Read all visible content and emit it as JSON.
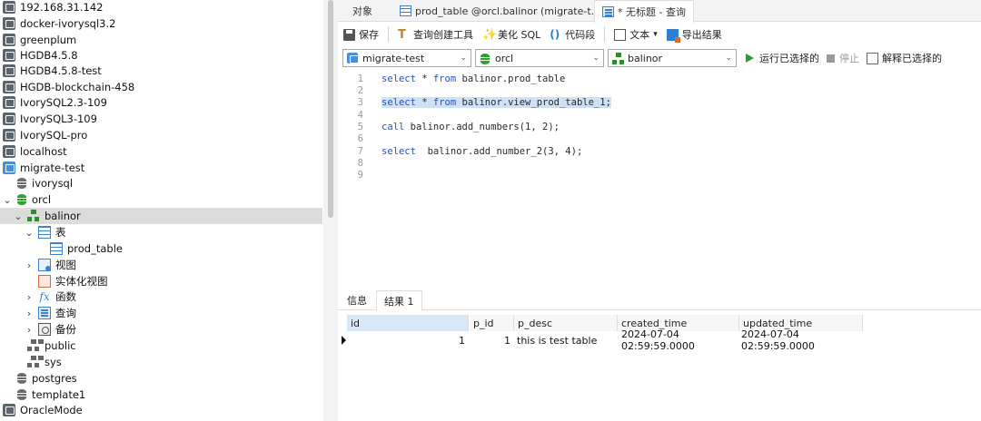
{
  "sidebar": {
    "items": [
      {
        "label": "192.168.31.142",
        "icon": "connection-icon"
      },
      {
        "label": "docker-ivorysql3.2",
        "icon": "connection-icon"
      },
      {
        "label": "greenplum",
        "icon": "connection-icon"
      },
      {
        "label": "HGDB4.5.8",
        "icon": "connection-icon"
      },
      {
        "label": "HGDB4.5.8-test",
        "icon": "connection-icon"
      },
      {
        "label": "HGDB-blockchain-458",
        "icon": "connection-icon"
      },
      {
        "label": "IvorySQL2.3-109",
        "icon": "connection-icon"
      },
      {
        "label": "IvorySQL3-109",
        "icon": "connection-icon"
      },
      {
        "label": "IvorySQL-pro",
        "icon": "connection-icon"
      },
      {
        "label": "localhost",
        "icon": "connection-icon"
      },
      {
        "label": "migrate-test",
        "icon": "connection-icon"
      },
      {
        "label": "ivorysql",
        "icon": "database-icon"
      },
      {
        "label": "orcl",
        "icon": "database-icon"
      },
      {
        "label": "balinor",
        "icon": "schema-icon"
      },
      {
        "label": "表",
        "icon": "table-folder-icon"
      },
      {
        "label": "prod_table",
        "icon": "table-icon"
      },
      {
        "label": "视图",
        "icon": "view-icon"
      },
      {
        "label": "实体化视图",
        "icon": "materialized-view-icon"
      },
      {
        "label": "函数",
        "icon": "function-icon"
      },
      {
        "label": "查询",
        "icon": "query-icon"
      },
      {
        "label": "备份",
        "icon": "backup-icon"
      },
      {
        "label": "public",
        "icon": "schema-icon"
      },
      {
        "label": "sys",
        "icon": "schema-icon"
      },
      {
        "label": "postgres",
        "icon": "database-icon"
      },
      {
        "label": "template1",
        "icon": "database-icon"
      },
      {
        "label": "OracleMode",
        "icon": "connection-icon"
      }
    ]
  },
  "tabs": [
    {
      "label": "对象"
    },
    {
      "label": "prod_table @orcl.balinor (migrate-t..."
    },
    {
      "label": "* 无标题 - 查询"
    }
  ],
  "toolbar": {
    "save": "保存",
    "query_builder": "查询创建工具",
    "beautify": "美化 SQL",
    "snippet": "代码段",
    "text": "文本",
    "export": "导出结果"
  },
  "connbar": {
    "connection": "migrate-test",
    "database": "orcl",
    "schema": "balinor",
    "run_selected": "运行已选择的",
    "stop": "停止",
    "explain_selected": "解释已选择的"
  },
  "editor": {
    "lines": [
      "select * from balinor.prod_table",
      "",
      "select * from balinor.view_prod_table_1;",
      "",
      "call balinor.add_numbers(1, 2);",
      "",
      "select  balinor.add_number_2(3, 4);",
      "",
      ""
    ]
  },
  "results": {
    "tabs": [
      "信息",
      "结果 1"
    ],
    "columns": [
      "id",
      "p_id",
      "p_desc",
      "created_time",
      "updated_time"
    ],
    "rows": [
      [
        "1",
        "1",
        "this is test table",
        "2024-07-04 02:59:59.0000",
        "2024-07-04 02:59:59.0000"
      ]
    ]
  }
}
